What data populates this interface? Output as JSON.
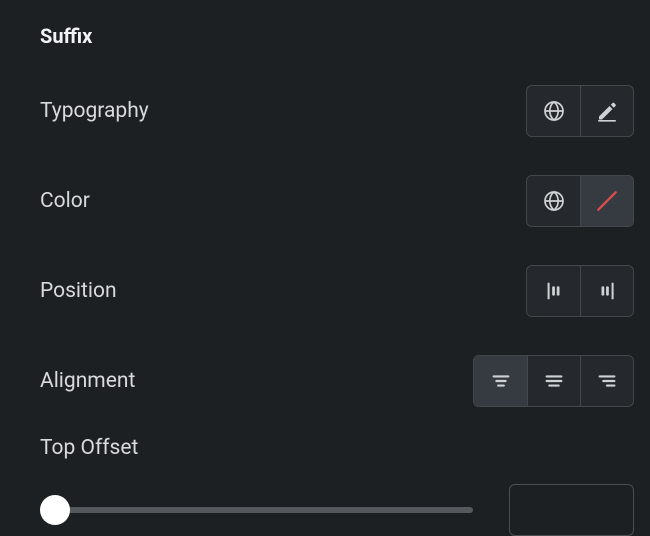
{
  "section": {
    "title": "Suffix"
  },
  "rows": {
    "typography": {
      "label": "Typography"
    },
    "color": {
      "label": "Color"
    },
    "position": {
      "label": "Position"
    },
    "alignment": {
      "label": "Alignment"
    },
    "topOffset": {
      "label": "Top Offset",
      "value": 0
    }
  },
  "controls": {
    "typography": {
      "options": [
        "global",
        "edit"
      ],
      "active": null
    },
    "color": {
      "options": [
        "global",
        "none"
      ],
      "active": "none"
    },
    "position": {
      "options": [
        "before",
        "after"
      ],
      "active": null
    },
    "alignment": {
      "options": [
        "center",
        "justify",
        "left"
      ],
      "active": "center"
    }
  }
}
